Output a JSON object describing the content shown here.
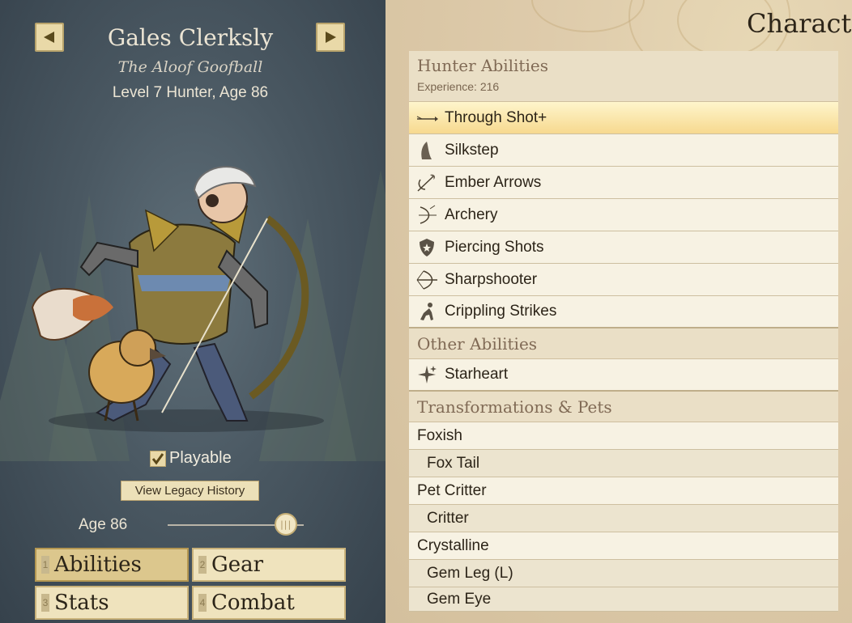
{
  "character": {
    "name": "Gales Clerksly",
    "title": "The Aloof Goofball",
    "level_line": "Level 7 Hunter, Age 86",
    "playable_label": "Playable",
    "playable_checked": true,
    "legacy_button": "View Legacy History",
    "age_label": "Age 86",
    "age_slider_value": 0.87
  },
  "tabs": [
    {
      "num": "1",
      "label": "Abilities",
      "active": true
    },
    {
      "num": "2",
      "label": "Gear",
      "active": false
    },
    {
      "num": "3",
      "label": "Stats",
      "active": false
    },
    {
      "num": "4",
      "label": "Combat",
      "active": false
    }
  ],
  "page_title": "Characte",
  "hunter_section": {
    "title": "Hunter Abilities",
    "experience": "Experience: 216",
    "abilities": [
      {
        "label": "Through Shot+",
        "icon": "arrow-icon",
        "selected": true
      },
      {
        "label": "Silkstep",
        "icon": "cloak-icon",
        "selected": false
      },
      {
        "label": "Ember Arrows",
        "icon": "flaming-arrow-icon",
        "selected": false
      },
      {
        "label": "Archery",
        "icon": "bow-icon",
        "selected": false
      },
      {
        "label": "Piercing Shots",
        "icon": "shield-icon",
        "selected": false
      },
      {
        "label": "Sharpshooter",
        "icon": "drawn-bow-icon",
        "selected": false
      },
      {
        "label": "Crippling Strikes",
        "icon": "kneeling-figure-icon",
        "selected": false
      }
    ]
  },
  "other_section": {
    "title": "Other Abilities",
    "abilities": [
      {
        "label": "Starheart",
        "icon": "sparkle-icon"
      }
    ]
  },
  "transform_section": {
    "title": "Transformations & Pets",
    "items": [
      {
        "label": "Foxish",
        "indent": false
      },
      {
        "label": "Fox Tail",
        "indent": true
      },
      {
        "label": "Pet Critter",
        "indent": false
      },
      {
        "label": "Critter",
        "indent": true
      },
      {
        "label": "Crystalline",
        "indent": false
      },
      {
        "label": "Gem Leg (L)",
        "indent": true
      },
      {
        "label": "Gem Eye",
        "indent": true
      }
    ]
  }
}
